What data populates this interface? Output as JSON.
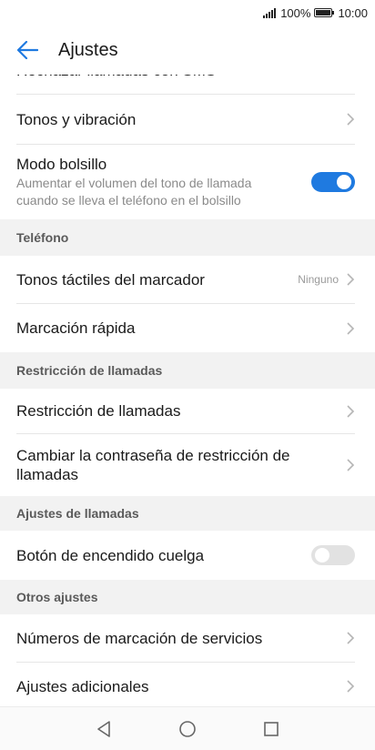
{
  "status_bar": {
    "battery": "100%",
    "time": "10:00"
  },
  "header": {
    "title": "Ajustes",
    "back_icon": "arrow-left-icon"
  },
  "colors": {
    "accent": "#1f7ae0",
    "section_bg": "#f2f2f2",
    "divider": "#e6e6e6"
  },
  "list": {
    "clipped_item": "Rechazar llamadas con SMS",
    "sound_vibration": "Tonos y vibración",
    "pocket_mode": {
      "label": "Modo bolsillo",
      "description": "Aumentar el volumen del tono de llamada cuando se lleva el teléfono en el bolsillo",
      "enabled": true
    },
    "sections": {
      "phone": "Teléfono",
      "call_barring": "Restricción de llamadas",
      "call_settings": "Ajustes de llamadas",
      "other": "Otros ajustes"
    },
    "dial_pad_tones": {
      "label": "Tonos táctiles del marcador",
      "value": "Ninguno"
    },
    "speed_dial": "Marcación rápida",
    "call_barring_item": "Restricción de llamadas",
    "change_barring_password": "Cambiar la contraseña de restricción de llamadas",
    "power_button_ends_call": {
      "label": "Botón de encendido cuelga",
      "enabled": false
    },
    "service_dial_numbers": "Números de marcación de servicios",
    "additional_settings": "Ajustes adicionales"
  },
  "nav_bar": {
    "back": "triangle-back-icon",
    "home": "circle-home-icon",
    "recents": "square-recents-icon"
  }
}
